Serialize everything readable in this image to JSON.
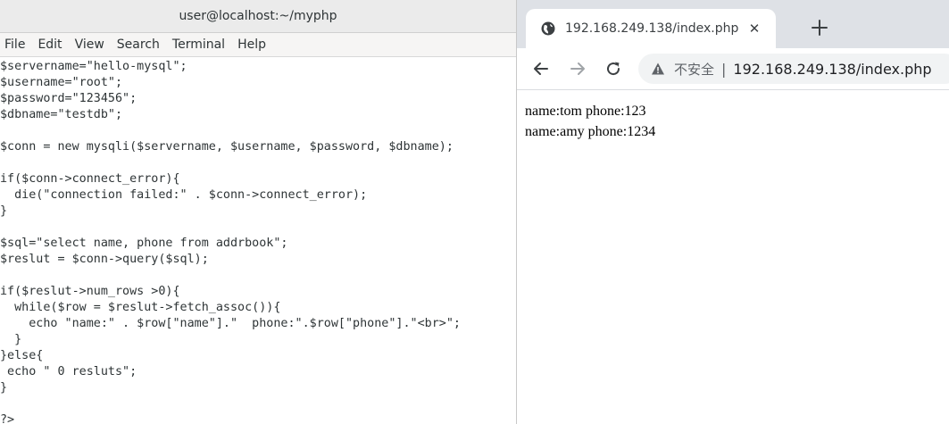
{
  "terminal": {
    "title": "user@localhost:~/myphp",
    "menu": [
      "File",
      "Edit",
      "View",
      "Search",
      "Terminal",
      "Help"
    ],
    "code_lines": [
      "$servername=\"hello-mysql\";",
      "$username=\"root\";",
      "$password=\"123456\";",
      "$dbname=\"testdb\";",
      "",
      "$conn = new mysqli($servername, $username, $password, $dbname);",
      "",
      "if($conn->connect_error){",
      "  die(\"connection failed:\" . $conn->connect_error);",
      "}",
      "",
      "$sql=\"select name, phone from addrbook\";",
      "$reslut = $conn->query($sql);",
      "",
      "if($reslut->num_rows >0){",
      "  while($row = $reslut->fetch_assoc()){",
      "    echo \"name:\" . $row[\"name\"].\"  phone:\".$row[\"phone\"].\"<br>\";",
      "  }",
      "}else{",
      " echo \" 0 resluts\";",
      "}",
      "",
      "?>"
    ]
  },
  "browser": {
    "tab": {
      "title": "192.168.249.138/index.php",
      "favicon": "globe-icon",
      "close": "✕"
    },
    "new_tab_icon": "plus-icon",
    "nav": {
      "back": "back-arrow-icon",
      "forward": "forward-arrow-icon",
      "reload": "reload-icon"
    },
    "address": {
      "warning_icon": "warning-triangle-icon",
      "security_label": "不安全",
      "separator": "|",
      "url": "192.168.249.138/index.php"
    },
    "content": [
      "name:tom phone:123",
      "name:amy phone:1234"
    ]
  },
  "colors": {
    "terminal_titlebar": "#ebebeb",
    "terminal_menubar": "#f6f5f4",
    "browser_tabstrip": "#dee1e6",
    "omnibox": "#f1f3f4",
    "text_dark": "#2e3436"
  }
}
